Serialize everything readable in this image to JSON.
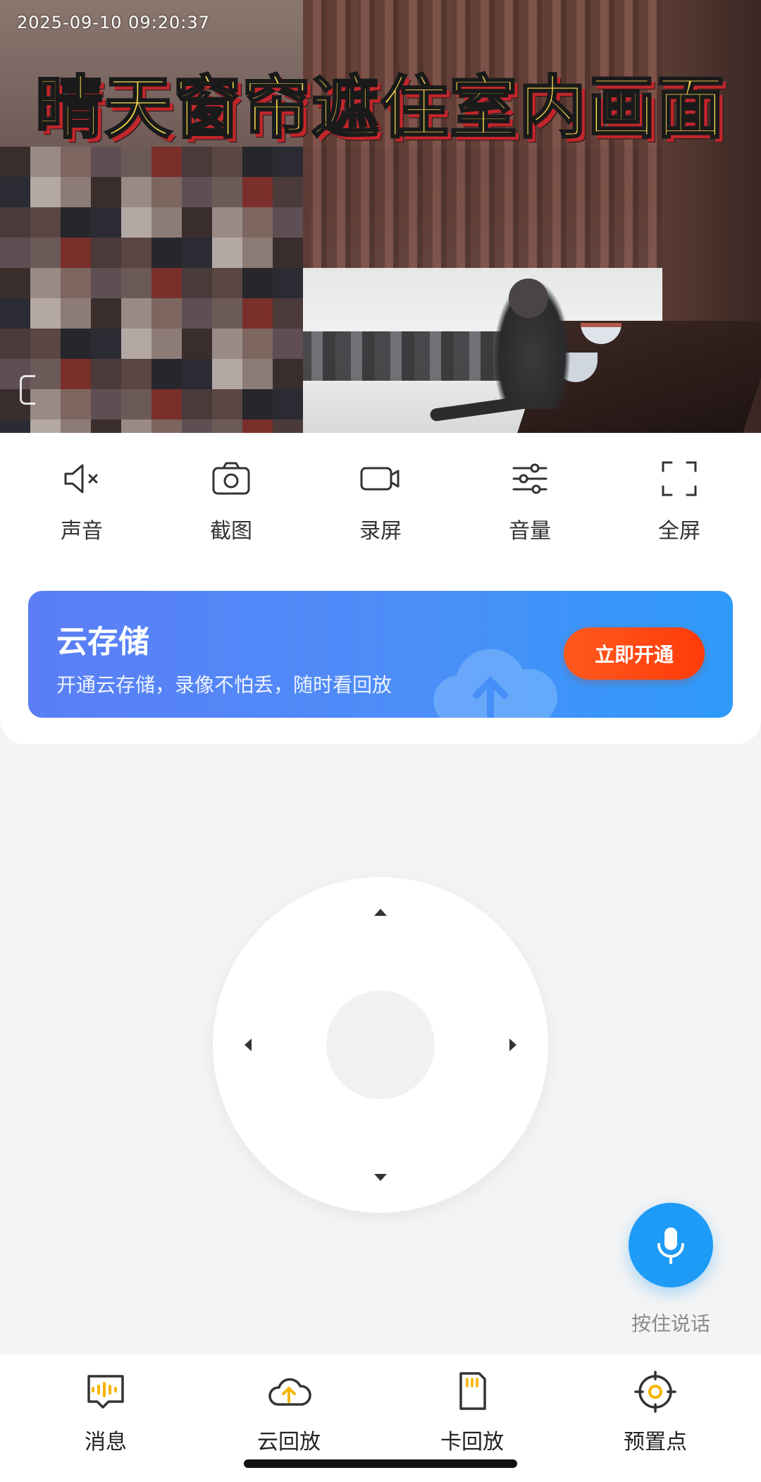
{
  "video": {
    "timestamp": "2025-09-10 09:20:37",
    "overlay_caption": "晴天窗帘遮住室内画面"
  },
  "toolbar": [
    {
      "label": "声音",
      "icon": "speaker-muted-icon"
    },
    {
      "label": "截图",
      "icon": "camera-icon"
    },
    {
      "label": "录屏",
      "icon": "video-camera-icon"
    },
    {
      "label": "音量",
      "icon": "sliders-icon"
    },
    {
      "label": "全屏",
      "icon": "fullscreen-icon"
    }
  ],
  "cloud_promo": {
    "title": "云存储",
    "subtitle": "开通云存储，录像不怕丢，随时看回放",
    "button_label": "立即开通"
  },
  "talk": {
    "label": "按住说话"
  },
  "bottom_nav": [
    {
      "label": "消息",
      "icon": "message-icon"
    },
    {
      "label": "云回放",
      "icon": "cloud-upload-icon"
    },
    {
      "label": "卡回放",
      "icon": "sd-card-icon"
    },
    {
      "label": "预置点",
      "icon": "target-icon"
    }
  ],
  "colors": {
    "accent_blue": "#1e9bf7",
    "promo_button": "#ff4a12",
    "nav_icon_yellow": "#f5b400"
  }
}
